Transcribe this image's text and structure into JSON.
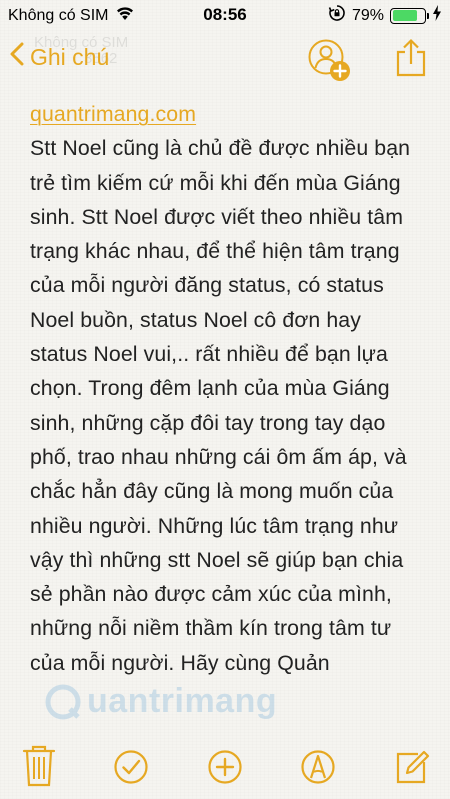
{
  "status_bar": {
    "carrier": "Không có SIM",
    "time": "08:56",
    "battery_percent": "79%",
    "battery_level": 0.79,
    "battery_color": "#4cd964"
  },
  "nav": {
    "back_label": "Ghi chú",
    "back_icon": "chevron-left-icon",
    "share_person_icon": "add-person-icon",
    "share_icon": "share-icon"
  },
  "note": {
    "link": "quantrimang.com",
    "body": "Stt Noel cũng là chủ đề được nhiều bạn trẻ tìm kiếm cứ mỗi khi đến mùa Giáng sinh. Stt Noel được viết theo nhiều tâm trạng khác nhau, để thể hiện tâm trạng của mỗi người đăng status, có status Noel buồn, status Noel cô đơn hay status Noel vui,.. rất nhiều để bạn lựa chọn. Trong đêm lạnh của mùa Giáng sinh, những cặp đôi tay trong tay dạo phố, trao nhau những cái ôm ấm áp, và chắc hẳn đây cũng là mong muốn của nhiều người. Những lúc tâm trạng như vậy thì những stt Noel sẽ giúp bạn chia sẻ phần nào được cảm xúc của mình, những nỗi niềm thầm kín trong tâm tư của mỗi người. Hãy cùng Quản"
  },
  "watermark": "uantrimang",
  "toolbar": {
    "items": [
      "trash-icon",
      "checklist-icon",
      "add-icon",
      "sketch-icon",
      "compose-icon"
    ]
  },
  "colors": {
    "accent": "#e6a822",
    "text": "#222222",
    "background": "#f5f4f0"
  }
}
